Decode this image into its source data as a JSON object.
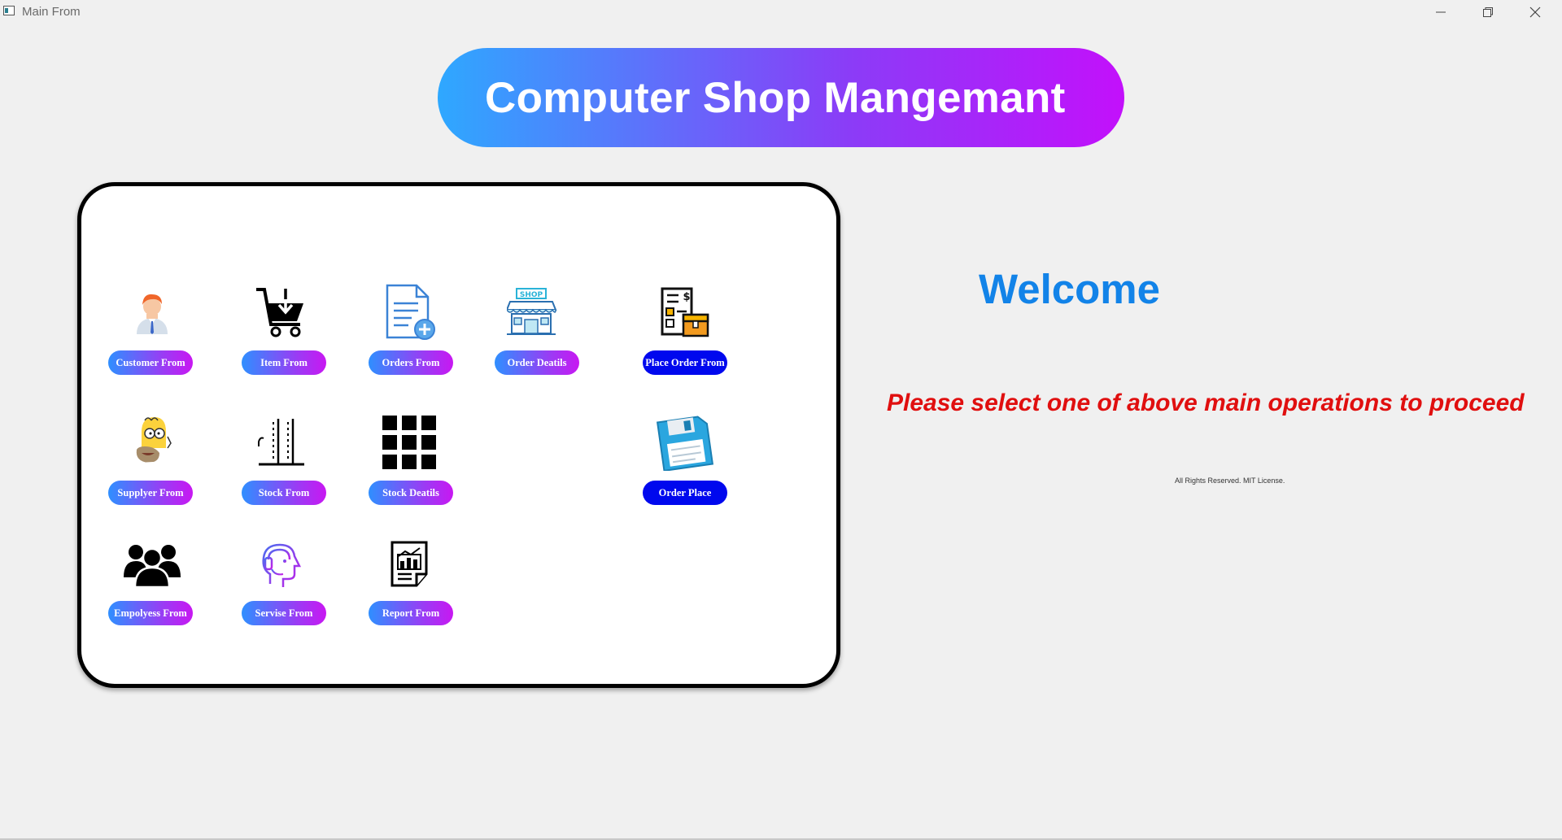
{
  "window": {
    "title": "Main From"
  },
  "header": {
    "title": "Computer Shop Mangemant"
  },
  "menu": {
    "customer": {
      "label": "Customer From",
      "icon": "customer-person-icon"
    },
    "item": {
      "label": "Item From",
      "icon": "shopping-cart-icon"
    },
    "orders": {
      "label": "Orders From",
      "icon": "document-add-icon"
    },
    "order_details": {
      "label": "Order Deatils",
      "icon": "shop-storefront-icon"
    },
    "place_order": {
      "label": "Place Order From",
      "icon": "invoice-box-icon"
    },
    "supplier": {
      "label": "Supplyer From",
      "icon": "cartoon-supplier-icon"
    },
    "stock": {
      "label": "Stock From",
      "icon": "stock-level-icon"
    },
    "stock_details": {
      "label": "Stock Deatils",
      "icon": "grid-icon"
    },
    "order_place": {
      "label": "Order Place",
      "icon": "floppy-disk-icon"
    },
    "employees": {
      "label": "Empolyess From",
      "icon": "people-group-icon"
    },
    "service": {
      "label": "Servise From",
      "icon": "headset-support-icon"
    },
    "report": {
      "label": "Report From",
      "icon": "report-chart-icon"
    },
    "shop_sign": "SHOP",
    "currency_sign": "$"
  },
  "main": {
    "welcome": "Welcome",
    "instruction": "Please select one of above main operations to proceed",
    "footer": "All Rights Reserved. MIT License."
  },
  "colors": {
    "gradient_start": "#2ea8ff",
    "gradient_end": "#c310fb",
    "welcome": "#1283e8",
    "instruction": "#e00f0f",
    "dark_button": "#0008ee"
  }
}
